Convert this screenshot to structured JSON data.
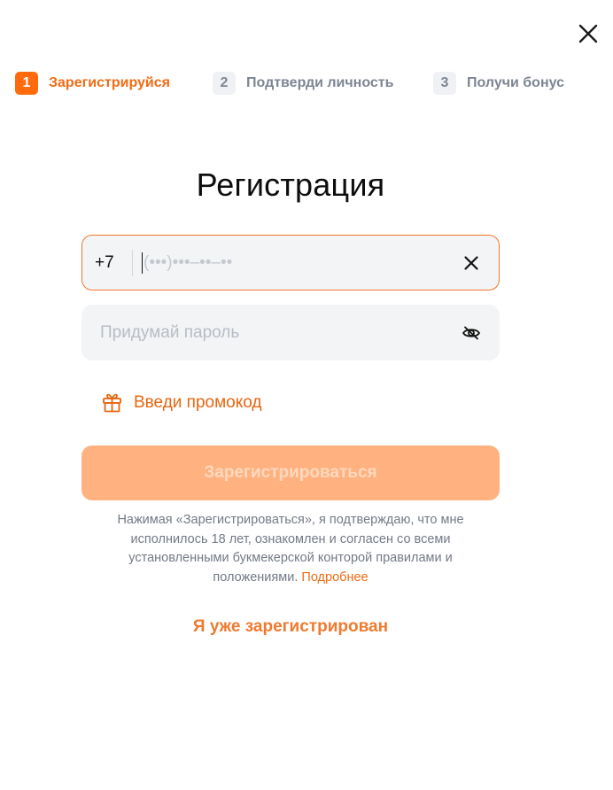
{
  "modal": {
    "close_icon": "close-icon"
  },
  "steps": [
    {
      "number": "1",
      "label": "Зарегистрируйся",
      "state": "active"
    },
    {
      "number": "2",
      "label": "Подтверди личность",
      "state": "inactive"
    },
    {
      "number": "3",
      "label": "Получи бонус",
      "state": "inactive"
    }
  ],
  "form": {
    "title": "Регистрация",
    "phone": {
      "prefix": "+7",
      "value": "",
      "placeholder": "(•••)•••–••–••",
      "clear_icon": "clear-icon"
    },
    "password": {
      "value": "",
      "placeholder": "Придумай пароль",
      "visibility_icon": "eye-off-icon"
    },
    "promo": {
      "label": "Введи промокод",
      "icon": "gift-icon"
    },
    "submit_label": "Зарегистрироваться",
    "legal": {
      "text": "Нажимая «Зарегистрироваться», я подтверждаю, что мне исполнилось 18 лет, ознакомлен и согласен со всеми установленными букмекерской конторой правилами и положениями.",
      "link_label": "Подробнее"
    },
    "login_link": "Я уже зарегистрирован"
  },
  "colors": {
    "accent": "#ff6b0d",
    "accent_text": "#f26b14",
    "submit_disabled_bg": "#ffb27f",
    "field_bg": "#f3f4f6",
    "muted_text": "#7d8593"
  }
}
